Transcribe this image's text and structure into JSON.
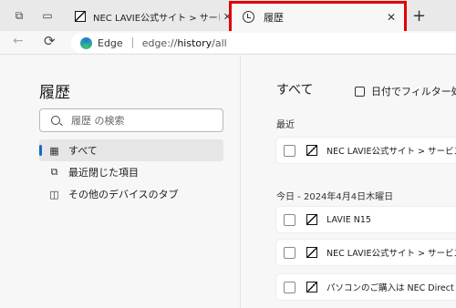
{
  "tabstrip": {
    "workspaces_icon": "workspaces-icon",
    "tab_actions_icon": "tab-actions-icon",
    "tabs": [
      {
        "title": "NEC LAVIE公式サイト > サービス＆サポート",
        "close": "✕"
      },
      {
        "title": "履歴",
        "close": "✕",
        "icon": "history-icon"
      }
    ],
    "new_tab": "+"
  },
  "toolbar": {
    "back": "←",
    "refresh": "⟳",
    "brand": "Edge",
    "url_scheme": "edge://",
    "url_host": "history",
    "url_path": "/all"
  },
  "sidebar": {
    "title": "履歴",
    "search_placeholder": "履歴 の検索",
    "items": [
      {
        "label": "すべて",
        "icon": "grid-icon"
      },
      {
        "label": "最近閉じた項目",
        "icon": "recently-closed-icon"
      },
      {
        "label": "その他のデバイスのタブ",
        "icon": "devices-icon"
      }
    ]
  },
  "main": {
    "title": "すべて",
    "filter_label": "日付でフィルター処理",
    "sections": [
      {
        "label": "最近",
        "entries": [
          "NEC LAVIE公式サイト > サービス＆サポート"
        ]
      },
      {
        "label": "今日 - 2024年4月4日木曜日",
        "entries": [
          "LAVIE N15",
          "NEC LAVIE公式サイト > サービス＆サポート",
          "パソコンのご購入は NEC Direct ｜NEC"
        ]
      }
    ]
  },
  "colors": {
    "highlight": "#e10000",
    "accent": "#0f6cbd"
  }
}
